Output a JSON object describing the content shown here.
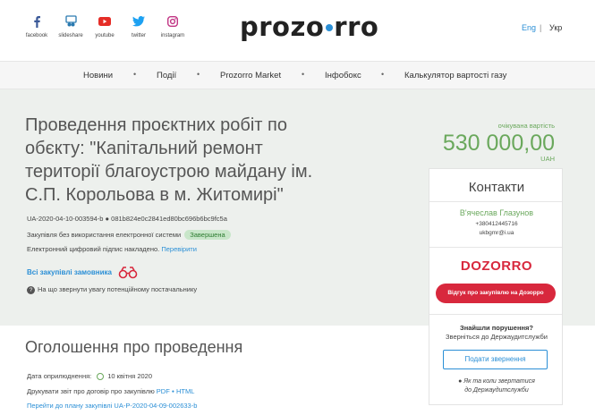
{
  "header": {
    "socials": [
      {
        "icon": "facebook-icon",
        "label": "facebook",
        "color": "#3b5998"
      },
      {
        "icon": "slideshare-icon",
        "label": "slideshare",
        "color": "#2a7ab0"
      },
      {
        "icon": "youtube-icon",
        "label": "youtube",
        "color": "#e52d27"
      },
      {
        "icon": "twitter-icon",
        "label": "twitter",
        "color": "#1da1f2"
      },
      {
        "icon": "instagram-icon",
        "label": "instagram",
        "color": "#c13584"
      }
    ],
    "logo_left": "prozo",
    "logo_right": "rro",
    "lang_eng": "Eng",
    "lang_sep": "|",
    "lang_ukr": "Укр"
  },
  "nav": {
    "items": [
      "Новини",
      "Події",
      "Prozorro Market",
      "Інфобокс",
      "Калькулятор вартості газу"
    ],
    "separator": "•"
  },
  "tender": {
    "title": "Проведення проєктних робіт по обєкту: \"Капітальний ремонт території благоустрою майдану ім. С.П. Корольова в м. Житомирі\"",
    "id_line": "UA-2020-04-10-003594-b ● 081b824e0c2841ed80bc696b6bc9fc5a",
    "procedure": "Закупівля без використання електронної системи",
    "status": "Завершена",
    "signature_text": "Електронний цифровий підпис накладено.",
    "signature_link": "Перевірити",
    "all_purchases": "Всі закупівлі замовника",
    "hint_icon": "?",
    "hint": "На що звернути увагу потенційному постачальнику",
    "expected_label": "очікувана вартість",
    "expected_value": "530 000,00",
    "currency": "UAH"
  },
  "contacts": {
    "title": "Контакти",
    "name": "В'ячеслав Глазунов",
    "phone": "+380412445716",
    "email": "ukbgmr@i.ua",
    "dozorro_logo": "DOZORRO",
    "dozorro_button": "Відгук про закупівлю на Дозорро",
    "violations_title": "Знайшли порушення?",
    "violations_sub": "Зверніться до Держаудитслужби",
    "appeal_button": "Подати звернення",
    "howto_line1": "Як та коли звертатися",
    "howto_line2": "до Держаудитслужби"
  },
  "announcement": {
    "title": "Оголошення про проведення",
    "pub_label": "Дата оприлюднення:",
    "pub_date": "10 квітня 2020",
    "print_text": "Друкувати звіт про договір про закупівлю",
    "print_pdf": "PDF",
    "print_sep": "●",
    "print_html": "HTML",
    "plan_link": "Перейти до плану закупівлі UA-P-2020-04-09-002633-b"
  },
  "colors": {
    "accent_blue": "#2b8fd6",
    "accent_green": "#6aa85c",
    "dozorro_red": "#d8283d",
    "section_bg": "#edf0ed"
  }
}
